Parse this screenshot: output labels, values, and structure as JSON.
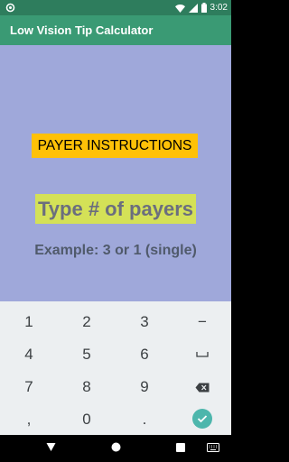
{
  "status_bar": {
    "time": "3:02",
    "left_icon": "circle-notification-icon",
    "icons": [
      "wifi-icon",
      "signal-icon",
      "battery-icon"
    ]
  },
  "app_bar": {
    "title": "Low Vision Tip Calculator"
  },
  "main": {
    "heading": "PAYER INSTRUCTIONS",
    "prompt": "Type # of payers",
    "example": "Example: 3 or 1 (single)"
  },
  "keyboard": {
    "keys": {
      "k1": "1",
      "k2": "2",
      "k3": "3",
      "minus": "−",
      "k4": "4",
      "k5": "5",
      "k6": "6",
      "k7": "7",
      "k8": "8",
      "k9": "9",
      "comma": ",",
      "k0": "0",
      "period": "."
    },
    "special_icons": [
      "space-icon",
      "backspace-icon",
      "done-check-icon"
    ]
  },
  "nav_bar": {
    "icons": [
      "back-triangle-icon",
      "home-circle-icon",
      "recents-square-icon",
      "keyboard-icon"
    ]
  },
  "colors": {
    "status_bar": "#2e7d5d",
    "app_bar": "#3a9a74",
    "content_bg": "#9fa8da",
    "heading_bg": "#ffc107",
    "prompt_bg": "#d4e157",
    "keyboard_bg": "#eceff1",
    "done_key": "#4db6ac"
  }
}
